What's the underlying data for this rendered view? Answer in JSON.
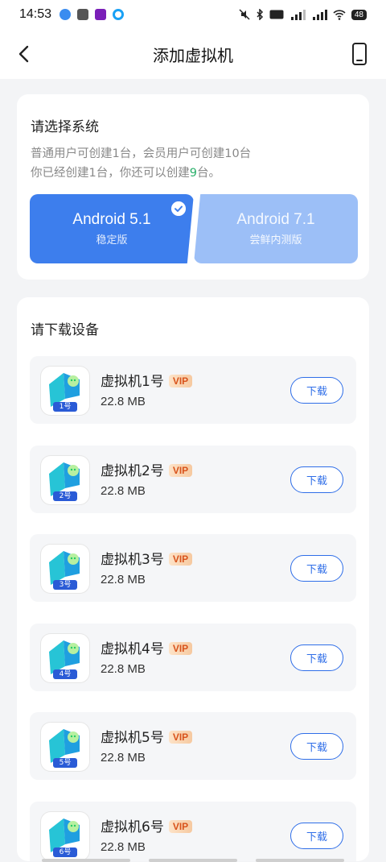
{
  "status": {
    "time": "14:53",
    "battery": "48"
  },
  "nav": {
    "title": "添加虚拟机"
  },
  "system_section": {
    "title": "请选择系统",
    "line1": "普通用户可创建1台，会员用户可创建10台",
    "line2_prefix": "你已经创建1台，你还可以创建",
    "line2_count": "9",
    "line2_suffix": "台。",
    "options": [
      {
        "name": "Android 5.1",
        "sub": "稳定版",
        "selected": true
      },
      {
        "name": "Android 7.1",
        "sub": "尝鲜内测版",
        "selected": false
      }
    ]
  },
  "download_section": {
    "title": "请下载设备",
    "button_label": "下载",
    "vip_label": "VIP",
    "items": [
      {
        "name": "虚拟机1号",
        "size": "22.8 MB",
        "badge": "1号"
      },
      {
        "name": "虚拟机2号",
        "size": "22.8 MB",
        "badge": "2号"
      },
      {
        "name": "虚拟机3号",
        "size": "22.8 MB",
        "badge": "3号"
      },
      {
        "name": "虚拟机4号",
        "size": "22.8 MB",
        "badge": "4号"
      },
      {
        "name": "虚拟机5号",
        "size": "22.8 MB",
        "badge": "5号"
      },
      {
        "name": "虚拟机6号",
        "size": "22.8 MB",
        "badge": "6号"
      }
    ]
  },
  "colors": {
    "primary": "#3d7eed",
    "secondary": "#9cbff7",
    "vip_text": "#d8531c",
    "accent_green": "#29b06a"
  }
}
